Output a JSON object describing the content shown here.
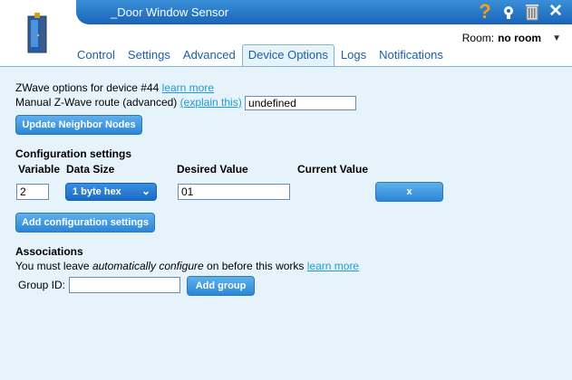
{
  "header": {
    "title": "_Door Window Sensor",
    "room_label": "Room:",
    "room_value": "no room",
    "icons": [
      "help-icon",
      "settings-icon",
      "trash-icon",
      "close-icon"
    ]
  },
  "tabs": [
    {
      "label": "Control"
    },
    {
      "label": "Settings"
    },
    {
      "label": "Advanced"
    },
    {
      "label": "Device Options",
      "active": true
    },
    {
      "label": "Logs"
    },
    {
      "label": "Notifications"
    }
  ],
  "zwave": {
    "options_text": "ZWave options for device #44",
    "learn_more": "learn more",
    "route_label": "Manual Z-Wave route (advanced)",
    "explain": "(explain this)",
    "route_value": "undefined",
    "update_button": "Update Neighbor Nodes"
  },
  "config": {
    "title": "Configuration settings",
    "headers": {
      "variable": "Variable",
      "data_size": "Data Size",
      "desired_value": "Desired Value",
      "current_value": "Current Value"
    },
    "rows": [
      {
        "variable": "2",
        "data_size": "1 byte hex",
        "desired_value": "01",
        "current_value": "",
        "remove_label": "x"
      }
    ],
    "add_button": "Add configuration settings"
  },
  "associations": {
    "title": "Associations",
    "note_before": "You must leave ",
    "note_emph": "automatically configure",
    "note_after": " on before this works ",
    "learn_more": "learn more",
    "group_label": "Group ID:",
    "group_value": "",
    "add_group_button": "Add group"
  },
  "colors": {
    "accent": "#1a64b8",
    "link": "#1c9bd6",
    "background": "#e6f3fb"
  }
}
